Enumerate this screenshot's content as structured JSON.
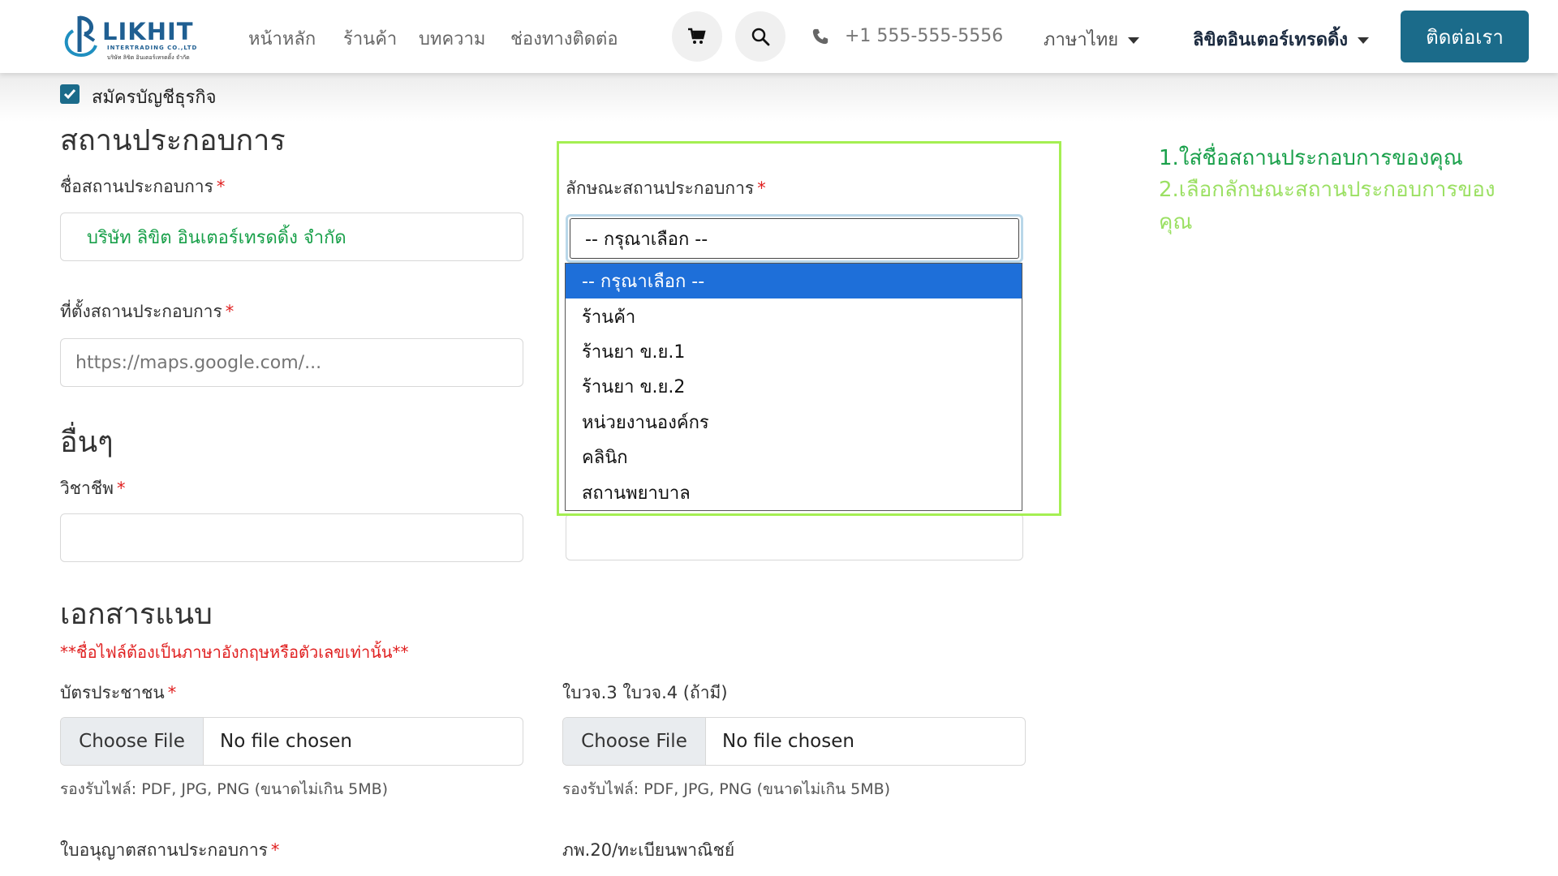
{
  "header": {
    "logo": {
      "name": "LIKHIT",
      "sub": "INTERTRADING CO.,LTD",
      "sub_thai": "บริษัท ลิขิต อินเตอร์เทรดดิ้ง จำกัด"
    },
    "nav": {
      "home": "หน้าหลัก",
      "shop": "ร้านค้า",
      "blog": "บทความ",
      "contact": "ช่องทางติดต่อ"
    },
    "phone": "+1 555-555-5556",
    "language": "ภาษาไทย",
    "account": "ลิขิตอินเตอร์เทรดดิ้ง",
    "contact_button": "ติดต่อเรา"
  },
  "form": {
    "business_checkbox_label": "สมัครบัญชีธุรกิจ",
    "section_business": "สถานประกอบการ",
    "business_name_label": "ชื่อสถานประกอบการ",
    "business_name_value": "บริษัท ลิขิต อินเตอร์เทรดดิ้ง จำกัด",
    "business_type_label": "ลักษณะสถานประกอบการ",
    "business_type_selected": "-- กรุณาเลือก --",
    "business_type_options": [
      "-- กรุณาเลือก --",
      "ร้านค้า",
      "ร้านยา ข.ย.1",
      "ร้านยา ข.ย.2",
      "หน่วยงานองค์กร",
      "คลินิก",
      "สถานพยาบาล"
    ],
    "location_label": "ที่ตั้งสถานประกอบการ",
    "location_placeholder": "https://maps.google.com/...",
    "section_other": "อื่นๆ",
    "occupation_label": "วิชาชีพ",
    "section_docs": "เอกสารแนบ",
    "file_name_warning": "**ชื่อไฟล์ต้องเป็นภาษาอังกฤษหรือตัวเลขเท่านั้น**",
    "id_card_label": "บัตรประชาชน",
    "vat_label": "ใบวจ.3 ใบวจ.4 (ถ้ามี)",
    "choose_file": "Choose File",
    "no_file": "No file chosen",
    "file_hint": "รองรับไฟล์: PDF, JPG, PNG (ขนาดไม่เกิน 5MB)",
    "license_label": "ใบอนุญาตสถานประกอบการ",
    "commerce_label": "ภพ.20/ทะเบียนพาณิชย์",
    "required_mark": "*"
  },
  "annotations": {
    "step1": "1.ใส่ชื่อสถานประกอบการของคุณ",
    "step2": "2.เลือกลักษณะสถานประกอบการของคุณ"
  },
  "colors": {
    "brand": "#1b6b8a",
    "highlight": "#a4ef52",
    "note_green": "#19a04a",
    "selected_option": "#1e6fd9",
    "required": "#e02020"
  }
}
